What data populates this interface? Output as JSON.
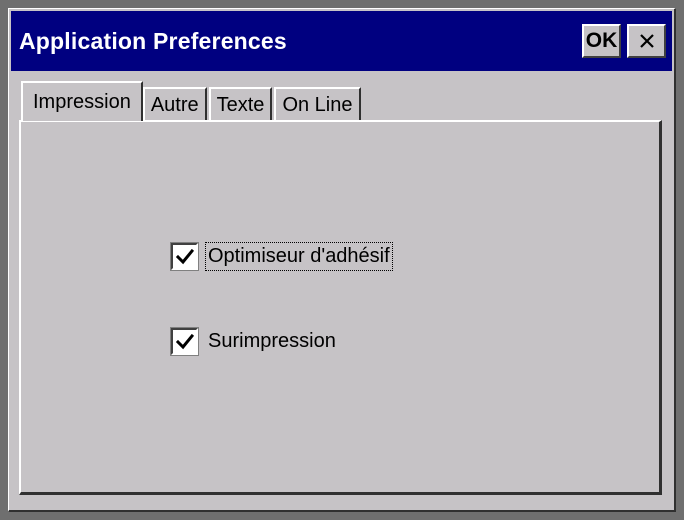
{
  "window": {
    "title": "Application Preferences",
    "ok_label": "OK",
    "close_icon": "close-icon"
  },
  "tabs": [
    {
      "label": "Impression",
      "active": true
    },
    {
      "label": "Autre",
      "active": false
    },
    {
      "label": "Texte",
      "active": false
    },
    {
      "label": "On Line",
      "active": false
    }
  ],
  "options": [
    {
      "label": "Optimiseur d'adhésif",
      "checked": true,
      "focused": true
    },
    {
      "label": "Surimpression",
      "checked": true,
      "focused": false
    }
  ],
  "colors": {
    "titlebar": "#000080",
    "face": "#c6c3c6"
  }
}
